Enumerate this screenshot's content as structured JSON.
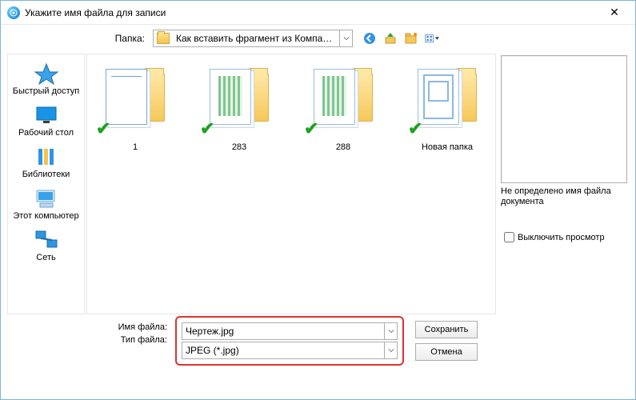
{
  "titlebar": {
    "title": "Укажите имя файла для записи"
  },
  "folder_row": {
    "label": "Папка:",
    "combo_text": "Как вставить фрагмент из Компаса в Вор"
  },
  "toolbar": {
    "back": "nav-back",
    "up": "nav-up",
    "new_folder": "new-folder",
    "view": "view-menu"
  },
  "sidebar": {
    "items": [
      {
        "label": "Быстрый доступ"
      },
      {
        "label": "Рабочий стол"
      },
      {
        "label": "Библиотеки"
      },
      {
        "label": "Этот компьютер"
      },
      {
        "label": "Сеть"
      }
    ]
  },
  "files": [
    {
      "name": "1"
    },
    {
      "name": "283"
    },
    {
      "name": "288"
    },
    {
      "name": "Новая папка"
    }
  ],
  "preview": {
    "message": "Не определено имя файла документа",
    "checkbox_label": "Выключить просмотр"
  },
  "bottom": {
    "filename_label": "Имя файла:",
    "filetype_label": "Тип файла:",
    "filename_value": "Чертеж.jpg",
    "filetype_value": "JPEG (*.jpg)",
    "save_label": "Сохранить",
    "cancel_label": "Отмена"
  }
}
